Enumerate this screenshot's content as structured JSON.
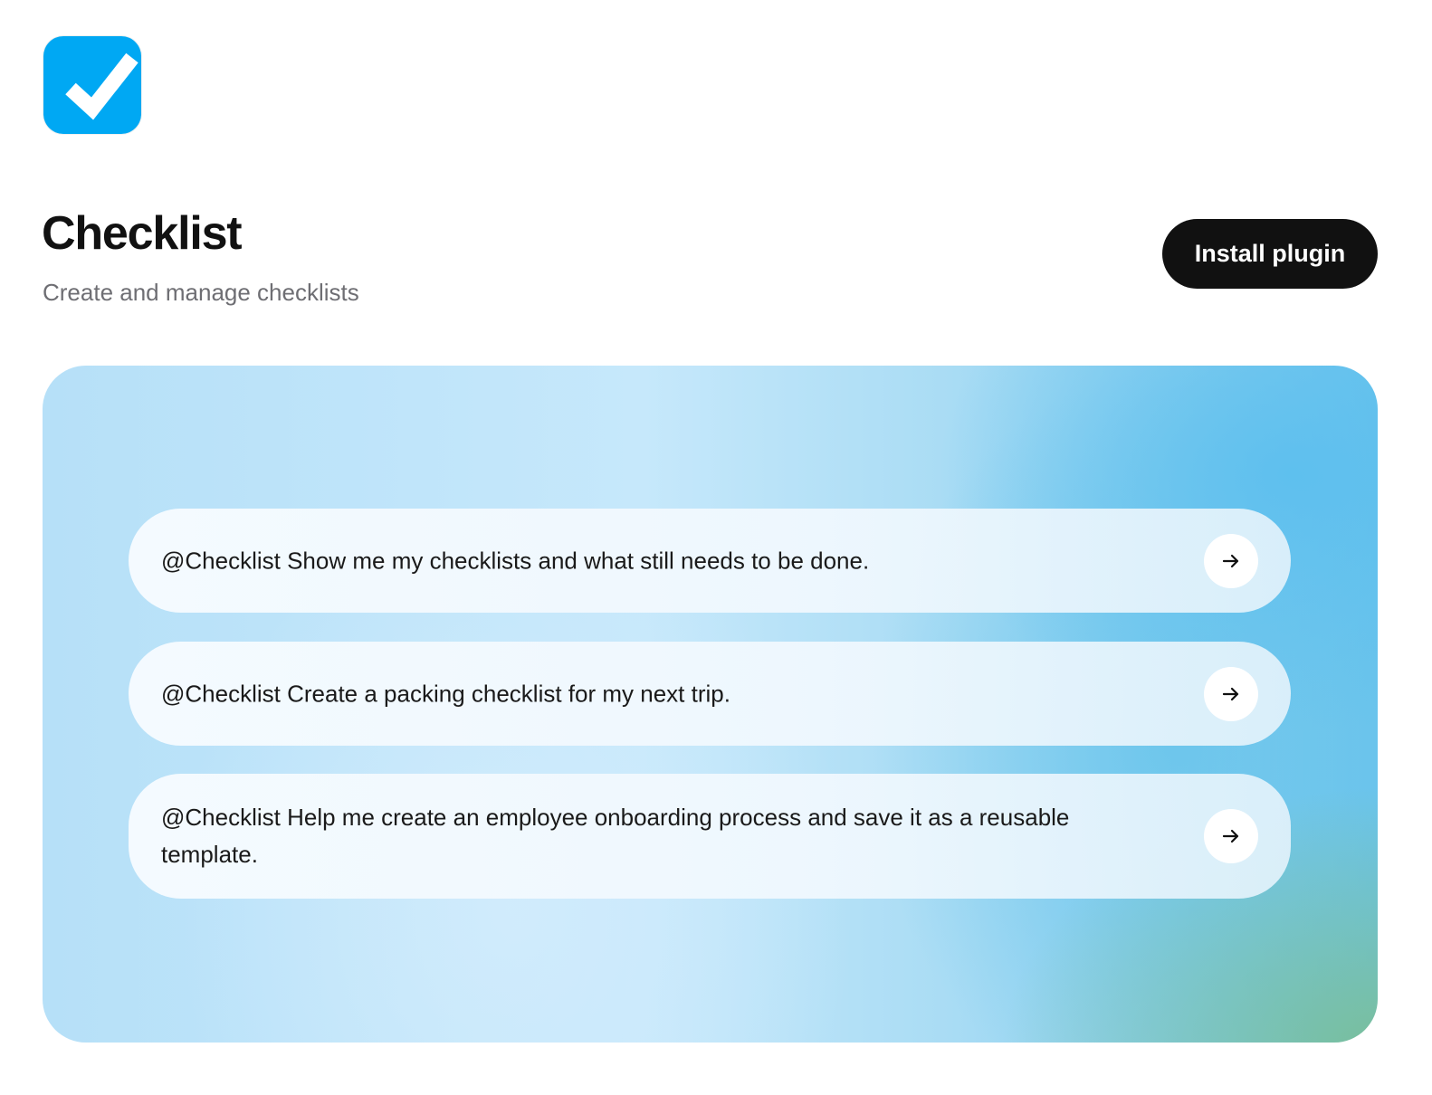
{
  "app": {
    "icon": "checkmark-app-icon",
    "icon_color": "#00a8f3",
    "title": "Checklist",
    "subtitle": "Create and manage checklists"
  },
  "actions": {
    "install_label": "Install plugin"
  },
  "prompts": [
    {
      "text": "@Checklist Show me my checklists and what still needs to be done.",
      "icon": "arrow-right-icon"
    },
    {
      "text": "@Checklist Create a packing checklist for my next trip.",
      "icon": "arrow-right-icon"
    },
    {
      "text": "@Checklist Help me create an employee onboarding process and save it as a reusable template.",
      "icon": "arrow-right-icon"
    }
  ]
}
